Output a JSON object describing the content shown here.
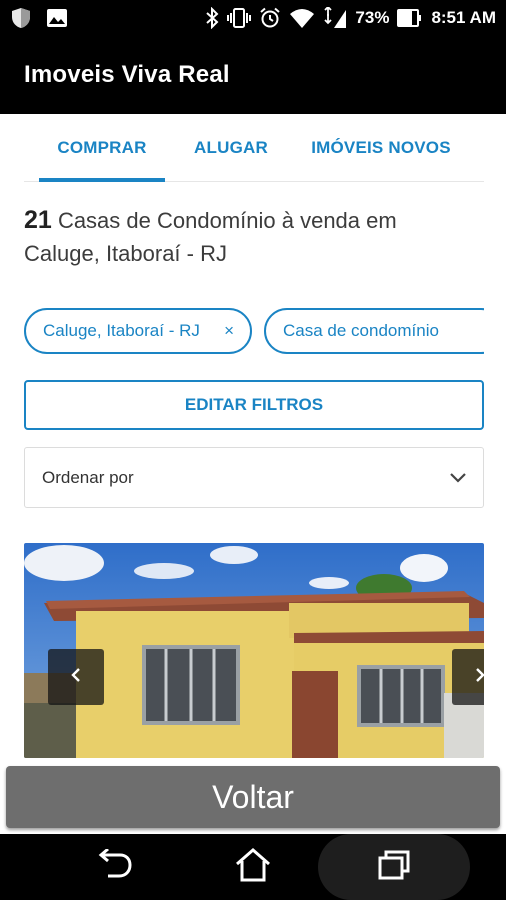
{
  "status_bar": {
    "battery": "73%",
    "time": "8:51 AM"
  },
  "app_bar": {
    "title": "Imoveis Viva Real"
  },
  "tabs": [
    {
      "label": "COMPRAR",
      "active": true
    },
    {
      "label": "ALUGAR",
      "active": false
    },
    {
      "label": "IMÓVEIS NOVOS",
      "active": false
    }
  ],
  "results": {
    "count": "21",
    "description": "Casas de Condomínio à venda em Caluge, Itaboraí - RJ"
  },
  "filters": {
    "chips": [
      {
        "label": "Caluge, Itaboraí - RJ",
        "remove": "×"
      },
      {
        "label": "Casa de condomínio",
        "remove": "×"
      }
    ],
    "edit_label": "EDITAR FILTROS"
  },
  "sort": {
    "label": "Ordenar por"
  },
  "bottom_button": {
    "label": "Voltar"
  },
  "colors": {
    "accent": "#1a84c4",
    "app_bar": "#000000",
    "voltar_bg": "#6e6e6e"
  },
  "icons": [
    "shield-icon",
    "image-icon",
    "bluetooth-icon",
    "vibrate-icon",
    "alarm-icon",
    "wifi-icon",
    "signal-icon",
    "battery-icon",
    "chevron-down-icon",
    "chevron-left-icon",
    "chevron-right-icon",
    "back-icon",
    "home-icon",
    "recent-apps-icon"
  ]
}
